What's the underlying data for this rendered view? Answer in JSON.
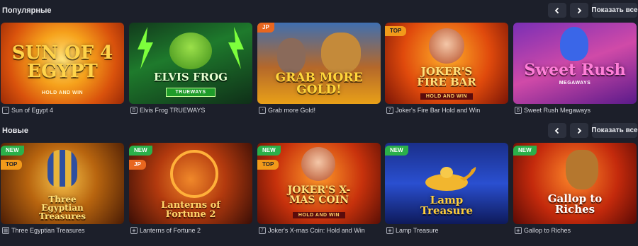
{
  "sections": [
    {
      "title": "Популярные",
      "show_all": "Показать все",
      "games": [
        {
          "thumb_title": "SUN OF 4 EGYPT",
          "thumb_sub": "HOLD AND WIN",
          "caption": "Sun of Egypt 4",
          "badges": []
        },
        {
          "thumb_title": "ELVIS FROG",
          "thumb_sub": "TRUEWAYS",
          "caption": "Elvis Frog TRUEWAYS",
          "badges": []
        },
        {
          "thumb_title": "GRAB MORE GOLD!",
          "thumb_sub": "",
          "caption": "Grab more Gold!",
          "badges": [
            "JP"
          ]
        },
        {
          "thumb_title": "JOKER'S FIRE BAR",
          "thumb_sub": "HOLD AND WIN",
          "caption": "Joker's Fire Bar Hold and Win",
          "badges": [
            "TOP"
          ]
        },
        {
          "thumb_title": "Sweet Rush",
          "thumb_sub": "MEGAWAYS",
          "caption": "Sweet Rush Megaways",
          "badges": []
        }
      ]
    },
    {
      "title": "Новые",
      "show_all": "Показать все",
      "games": [
        {
          "thumb_title": "Three Egyptian Treasures",
          "thumb_sub": "",
          "caption": "Three Egyptian Treasures",
          "badges": [
            "NEW",
            "TOP"
          ]
        },
        {
          "thumb_title": "Lanterns of Fortune 2",
          "thumb_sub": "",
          "caption": "Lanterns of Fortune 2",
          "badges": [
            "NEW",
            "JP"
          ]
        },
        {
          "thumb_title": "JOKER'S X-MAS COIN",
          "thumb_sub": "HOLD AND WIN",
          "caption": "Joker's X-mas Coin: Hold and Win",
          "badges": [
            "NEW",
            "TOP"
          ]
        },
        {
          "thumb_title": "Lamp Treasure",
          "thumb_sub": "",
          "caption": "Lamp Treasure",
          "badges": [
            "NEW"
          ]
        },
        {
          "thumb_title": "Gallop to Riches",
          "thumb_sub": "",
          "caption": "Gallop to Riches",
          "badges": [
            "NEW"
          ]
        }
      ]
    }
  ]
}
